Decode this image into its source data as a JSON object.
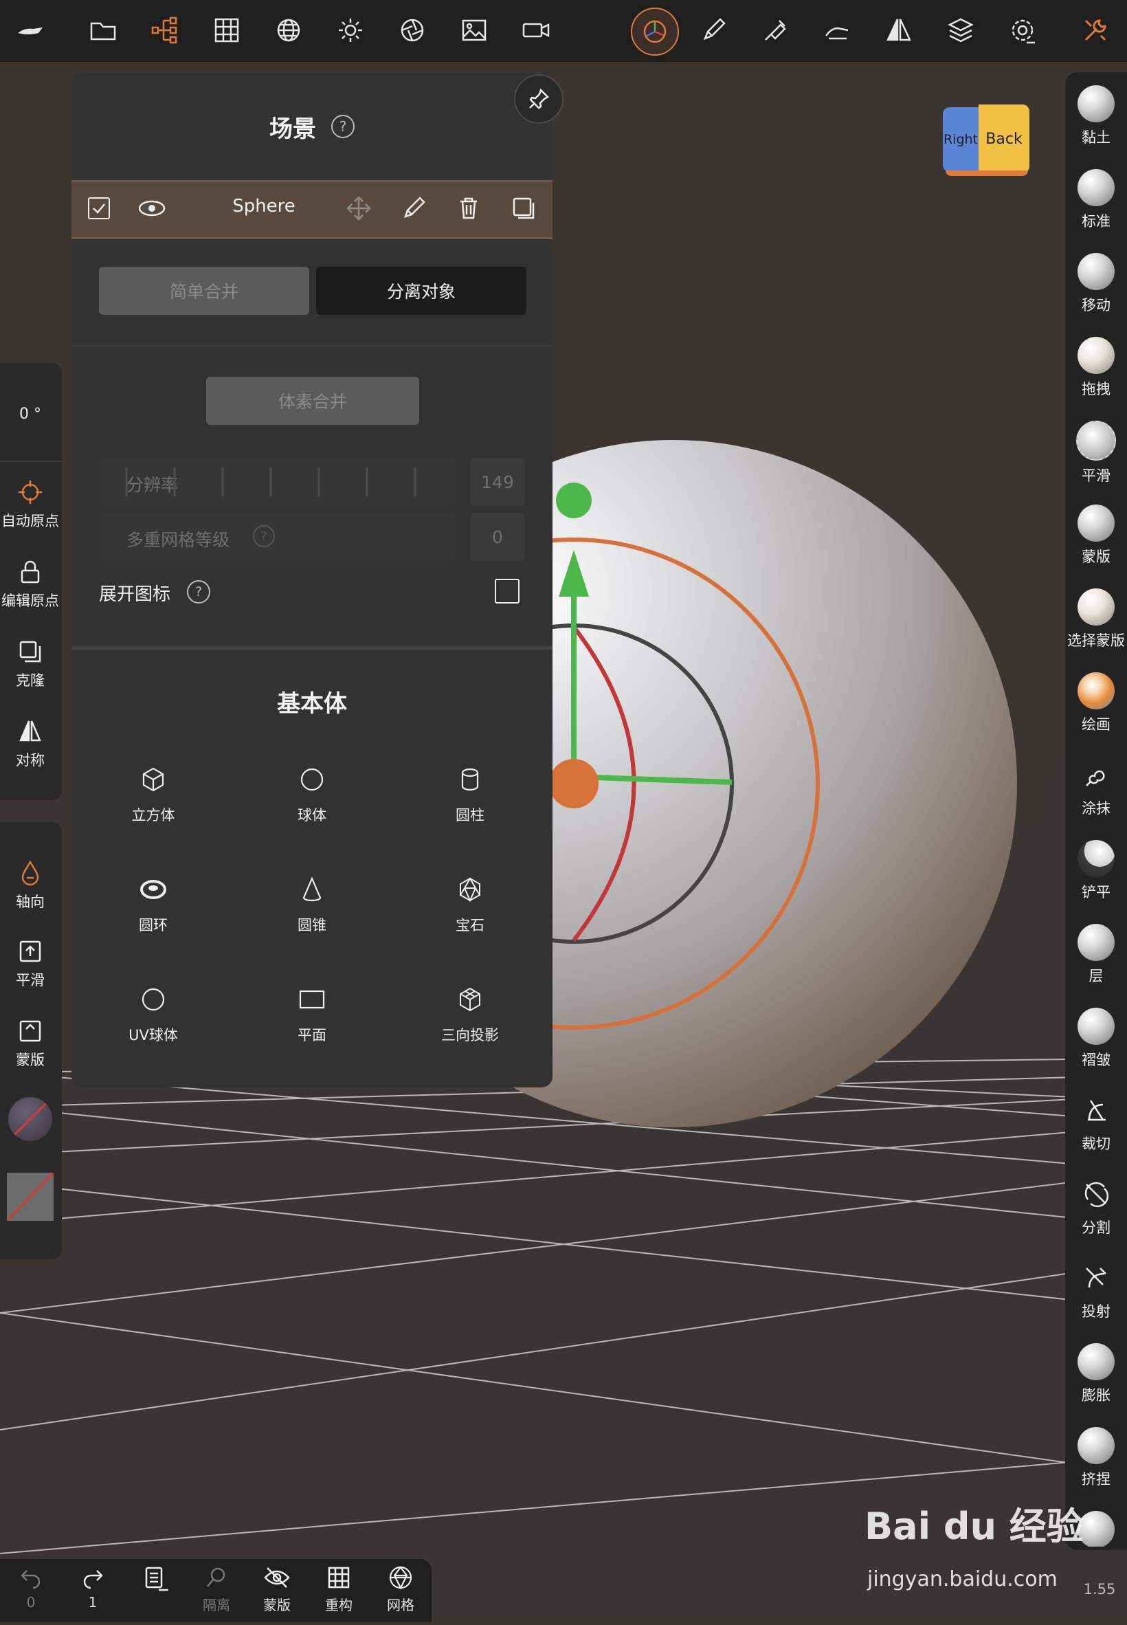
{
  "scene_panel": {
    "title": "场景",
    "object": {
      "name": "Sphere"
    },
    "merge_buttons": {
      "simple_merge": "简单合并",
      "separate": "分离对象"
    },
    "voxel_merge": "体素合并",
    "resolution": {
      "label": "分辨率",
      "value": "149"
    },
    "multires": {
      "label": "多重网格等级",
      "value": "0"
    },
    "expand_icons": {
      "label": "展开图标"
    },
    "primitives": {
      "title": "基本体",
      "items": [
        {
          "label": "立方体",
          "icon": "cube-icon"
        },
        {
          "label": "球体",
          "icon": "sphere-icon"
        },
        {
          "label": "圆柱",
          "icon": "cylinder-icon"
        },
        {
          "label": "圆环",
          "icon": "torus-icon"
        },
        {
          "label": "圆锥",
          "icon": "cone-icon"
        },
        {
          "label": "宝石",
          "icon": "gem-icon"
        },
        {
          "label": "UV球体",
          "icon": "uv-sphere-icon"
        },
        {
          "label": "平面",
          "icon": "plane-icon"
        },
        {
          "label": "三向投影",
          "icon": "triplanar-icon"
        }
      ]
    }
  },
  "left_panel": {
    "angle": "0 °",
    "auto_origin": "自动原点",
    "edit_origin": "编辑原点",
    "clone": "克隆",
    "symmetry": "对称",
    "axis": "轴向",
    "smooth": "平滑",
    "mask": "蒙版"
  },
  "right_tools": [
    {
      "label": "黏土"
    },
    {
      "label": "标准"
    },
    {
      "label": "移动"
    },
    {
      "label": "拖拽"
    },
    {
      "label": "平滑"
    },
    {
      "label": "蒙版"
    },
    {
      "label": "选择蒙版"
    },
    {
      "label": "绘画"
    },
    {
      "label": "涂抹"
    },
    {
      "label": "铲平"
    },
    {
      "label": "层"
    },
    {
      "label": "褶皱"
    },
    {
      "label": "裁切"
    },
    {
      "label": "分割"
    },
    {
      "label": "投射"
    },
    {
      "label": "膨胀"
    },
    {
      "label": "挤捏"
    }
  ],
  "bottom_bar": {
    "undo_count": "0",
    "redo_count": "1",
    "isolate": "隔离",
    "mask": "蒙版",
    "remesh": "重构",
    "mesh": "网格"
  },
  "view_cube": {
    "right": "Right",
    "back": "Back"
  },
  "zoom_value": "1.55",
  "watermark": {
    "logo": "Bai du 经验",
    "url": "jingyan.baidu.com"
  },
  "colors": {
    "accent_orange": "#e07a3a",
    "panel_bg": "#323232",
    "topbar_bg": "#1f1f1f"
  }
}
